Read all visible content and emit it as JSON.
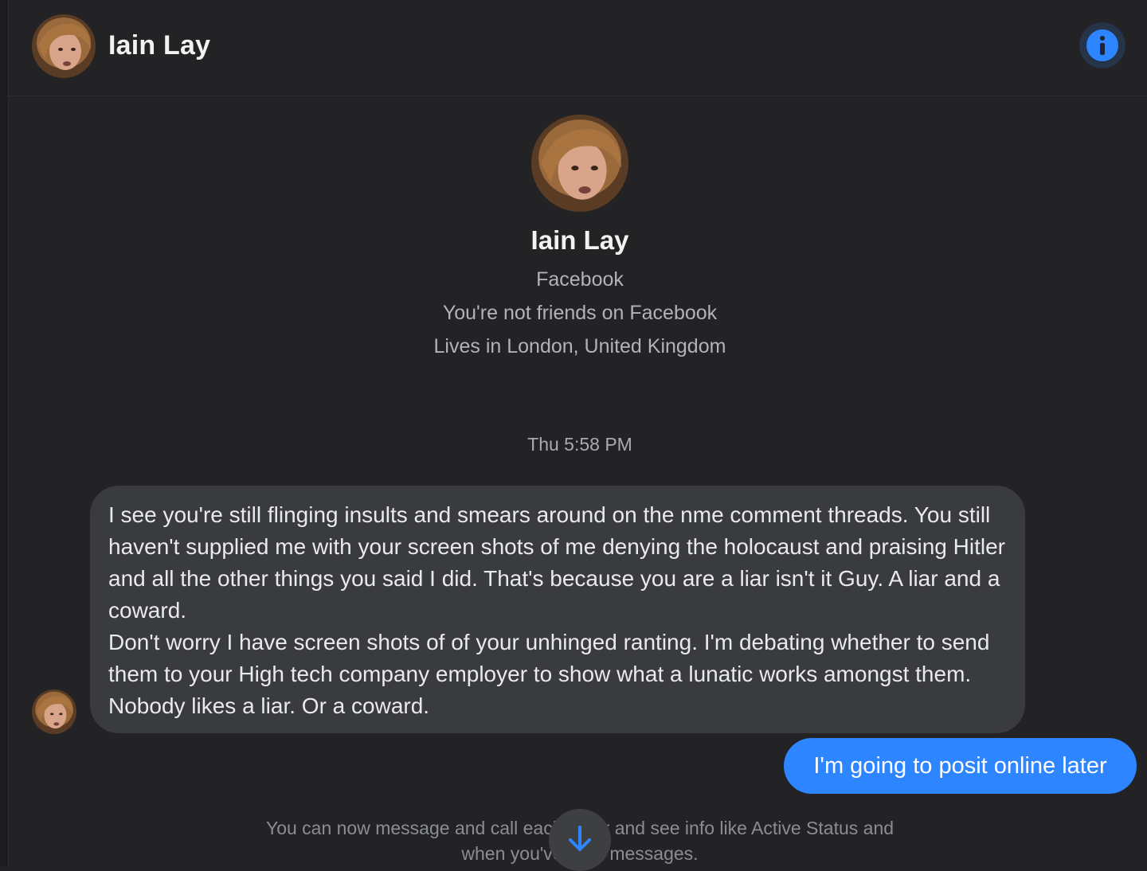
{
  "header": {
    "contact_name": "Iain Lay",
    "info_icon": "info-icon"
  },
  "profile": {
    "name": "Iain Lay",
    "platform": "Facebook",
    "friend_status": "You're not friends on Facebook",
    "location": "Lives in London, United Kingdom"
  },
  "conversation": {
    "timestamp": "Thu 5:58 PM",
    "incoming_message": {
      "lines": [
        "I see you're still flinging insults and smears around on the nme comment threads. You still haven't supplied me with your screen shots of me denying the holocaust and praising Hitler and all the other things you said I did. That's because you are a liar isn't it Guy. A liar and a coward.",
        "Don't worry I have screen shots of of your unhinged ranting. I'm debating whether to send them to your High tech company employer to show what a lunatic works amongst them. Nobody likes a liar. Or a coward."
      ]
    },
    "outgoing_message": "I'm going to posit online later"
  },
  "notice": {
    "line1": "You can now message and call each other and see info like Active Status and",
    "line2": "when you've read messages."
  },
  "scroll_down_icon": "arrow-down-icon",
  "colors": {
    "background": "#232325",
    "incoming_bubble": "#3a3b3d",
    "outgoing_bubble": "#2d86ff",
    "accent": "#2d86ff"
  }
}
